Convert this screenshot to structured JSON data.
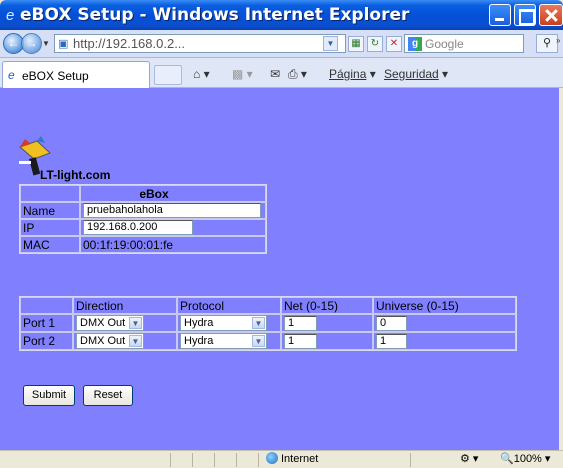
{
  "window": {
    "title": "eBOX Setup - Windows Internet Explorer"
  },
  "addressbar": {
    "url": "http://192.168.0.2...",
    "search_placeholder": "Google"
  },
  "tabbar": {
    "tab_label": "eBOX Setup",
    "page_menu": "Página",
    "security_menu": "Seguridad"
  },
  "page": {
    "brand": "LT-light.com",
    "ebox": {
      "header": "eBox",
      "name_label": "Name",
      "name_value": "pruebaholahola",
      "ip_label": "IP",
      "ip_value": "192.168.0.200",
      "mac_label": "MAC",
      "mac_value": "00:1f:19:00:01:fe"
    },
    "ports": {
      "headers": [
        "Direction",
        "Protocol",
        "Net (0-15)",
        "Universe (0-15)"
      ],
      "rows": [
        {
          "label": "Port 1",
          "direction": "DMX Out",
          "protocol": "Hydra",
          "net": "1",
          "universe": "0"
        },
        {
          "label": "Port 2",
          "direction": "DMX Out",
          "protocol": "Hydra",
          "net": "1",
          "universe": "1"
        }
      ]
    },
    "submit_label": "Submit",
    "reset_label": "Reset"
  },
  "statusbar": {
    "zone": "Internet",
    "zoom": "100%"
  },
  "colors": {
    "page_background": "#8080ff",
    "titlebar": "#0550d8"
  }
}
